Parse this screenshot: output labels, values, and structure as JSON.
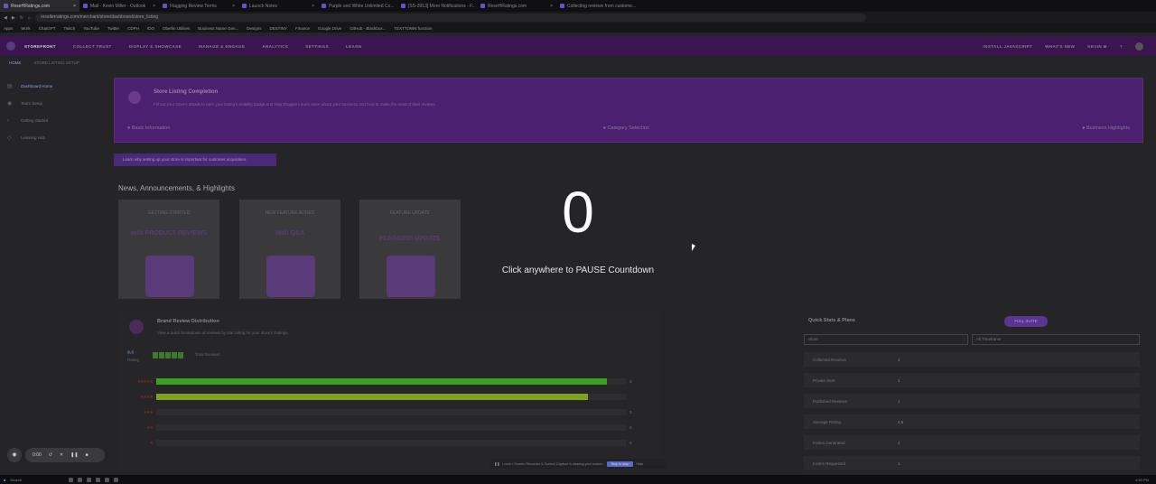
{
  "browser": {
    "tabs": [
      {
        "label": "ReseHRatings.com",
        "active": true
      },
      {
        "label": "Mail - Kevin Miller - Outlook"
      },
      {
        "label": "Flagging Review Terms"
      },
      {
        "label": "Launch Notes"
      },
      {
        "label": "Purple and White Unlimited Co..."
      },
      {
        "label": "[SS-3913] More Notifications - F..."
      },
      {
        "label": "ReseHRatings.com"
      },
      {
        "label": "Collecting reviews from custome..."
      }
    ],
    "url": "resellerratings.com/merchant/store/dashboard/store_listing",
    "bookmarks": [
      "Apps",
      "Work",
      "ChatGPT",
      "Twitch",
      "YouTube",
      "Twitter",
      "CDPH",
      "IDO",
      "Oberlin Utilities",
      "Business Name Gen...",
      "Designs",
      "DESTINY",
      "Finance",
      "Google Drive",
      "GitHub - Blackbox...",
      "TEXTTOWN function"
    ]
  },
  "topnav": {
    "items": [
      "STOREFRONT",
      "COLLECT TRUST",
      "DISPLAY & SHOWCASE",
      "MANAGE & ENGAGE",
      "ANALYTICS",
      "SETTINGS",
      "LEARN"
    ],
    "right": [
      "INSTALL JAVASCRIPT",
      "WHAT'S NEW",
      "KEVIN M"
    ]
  },
  "subnav": {
    "items": [
      "HOME",
      "STORE LISTING SETUP"
    ]
  },
  "sidebar": {
    "items": [
      "Dashboard Home",
      "Team Setup",
      "Getting Started",
      "Learning Hub"
    ]
  },
  "banner": {
    "title": "Store Listing Completion",
    "desc": "Fill out your store's details to earn your listing's visibility badge and help shoppers learn more about your business and how to make the most of their reviews.",
    "steps": [
      "Basic Information",
      "Category Selection",
      "Business Highlights"
    ]
  },
  "learn_button": "Learn why setting up your store is important for customer acquisition.",
  "news": {
    "title": "News, Announcements, & Highlights",
    "cards": [
      {
        "top": "GETTING STARTED",
        "headline": "with PRODUCT REVIEWS"
      },
      {
        "top": "NEW FEATURE ADDED",
        "headline": "With Q&A"
      },
      {
        "top": "FEATURE UPDATE",
        "headline": "FLAGGING UPDATE"
      }
    ]
  },
  "brand": {
    "title": "Brand Review Distribution",
    "desc": "View a quick breakdown of reviews by star rating for your store's Ratings.",
    "score": "4.4",
    "score_label": "Rating",
    "count_label": "Total Reviews",
    "rows": [
      {
        "stars": "★★★★★",
        "count": "3",
        "fill": 0.96,
        "color": "#3aa01e"
      },
      {
        "stars": "★★★★",
        "count": "",
        "fill": 0.92,
        "color": "#7ea21e"
      },
      {
        "stars": "★★★",
        "count": "0",
        "fill": 0,
        "color": "#555"
      },
      {
        "stars": "★★",
        "count": "0",
        "fill": 0,
        "color": "#555"
      },
      {
        "stars": "★",
        "count": "0",
        "fill": 0,
        "color": "#555"
      }
    ]
  },
  "quickstats": {
    "title": "Quick Stats & Plans",
    "button": "FULL SUITE",
    "select1": "Store",
    "select2": "All Timeframe",
    "stats": [
      {
        "label": "Collected Reviews",
        "value": "1"
      },
      {
        "label": "Private Sent",
        "value": "1"
      },
      {
        "label": "Published Reviews",
        "value": "1"
      },
      {
        "label": "Average Rating",
        "value": "4.5"
      },
      {
        "label": "Invites Generated",
        "value": "1"
      },
      {
        "label": "Invites Requested",
        "value": "1"
      }
    ]
  },
  "overlay": {
    "count": "0",
    "message": "Click anywhere to PAUSE Countdown"
  },
  "recorder": {
    "time": "0:00",
    "note": "Loom • Screen Recorder & Screen Capture is sharing your screen.",
    "skip": "Skip to stop",
    "hide": "Hide"
  },
  "taskbar": {
    "search": "Search",
    "time": "4:30 PM"
  }
}
